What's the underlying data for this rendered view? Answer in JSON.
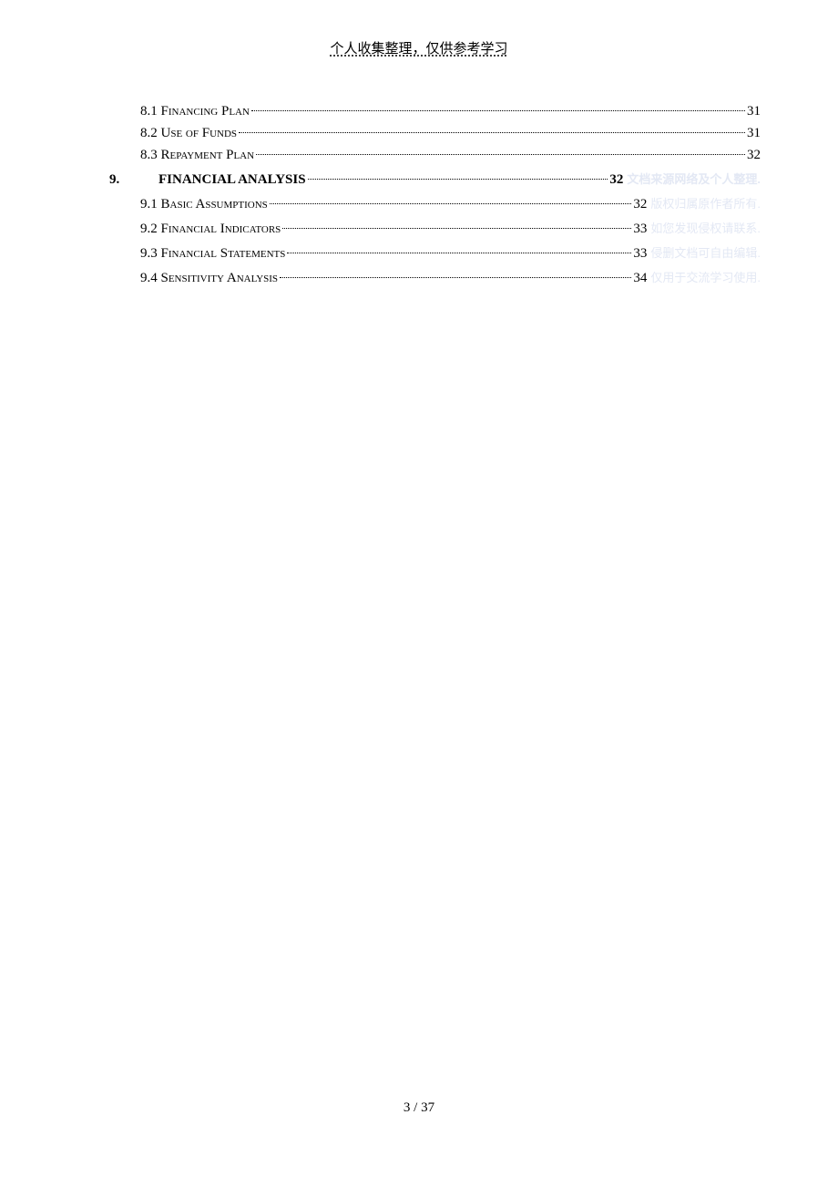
{
  "header": {
    "text": "个人收集整理，仅供参考学习"
  },
  "toc": {
    "sub_8": [
      {
        "label": "8.1 Financing Plan",
        "page": "31"
      },
      {
        "label": "8.2 Use of Funds",
        "page": "31"
      },
      {
        "label": "8.3 Repayment Plan",
        "page": "32"
      }
    ],
    "section_9": {
      "num": "9.",
      "title": "FINANCIAL ANALYSIS",
      "page": "32",
      "annotation": "文档来源网络及个人整理."
    },
    "sub_9": [
      {
        "label": "9.1 Basic Assumptions",
        "page": "32",
        "annotation": "版权归属原作者所有."
      },
      {
        "label": "9.2 Financial Indicators",
        "page": "33",
        "annotation": "如您发现侵权请联系."
      },
      {
        "label": "9.3 Financial Statements",
        "page": "33",
        "annotation": "侵删文档可自由编辑."
      },
      {
        "label": "9.4 Sensitivity Analysis",
        "page": "34",
        "annotation": "仅用于交流学习使用."
      }
    ]
  },
  "footer": {
    "current": "3",
    "sep": " / ",
    "total": "37"
  }
}
